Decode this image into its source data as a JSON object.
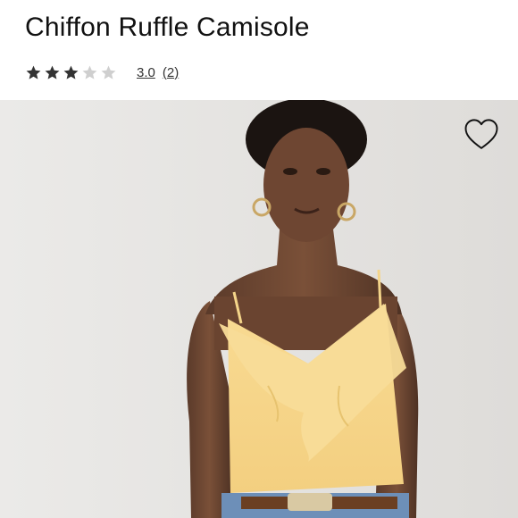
{
  "product": {
    "title": "Chiffon Ruffle Camisole",
    "rating": {
      "value": "3.0",
      "stars_filled": 3,
      "stars_total": 5,
      "review_count": "(2)",
      "filled_color": "#333333",
      "empty_color": "#cfcfcf"
    },
    "image": {
      "description_icon": "product-photo",
      "background_color": "#e6e5e3",
      "garment_color": "#f7d78e"
    },
    "favorite": {
      "icon": "heart-outline-icon"
    }
  }
}
